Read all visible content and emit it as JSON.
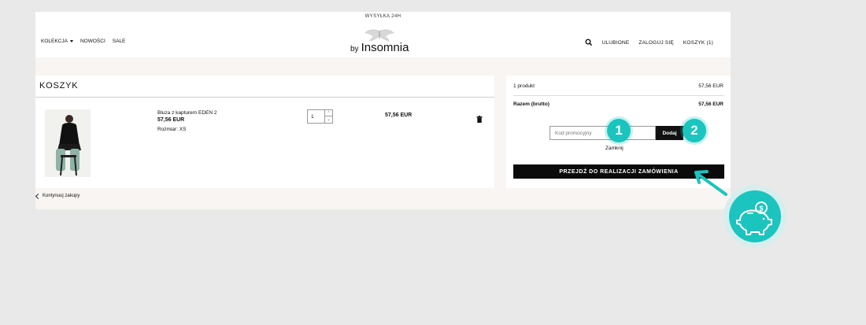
{
  "header": {
    "topbar": "WYSYŁKA 24H",
    "nav_left": [
      {
        "label": "KOLEKCJA"
      },
      {
        "label": "NOWOŚCI"
      },
      {
        "label": "SALE"
      }
    ],
    "logo_by": "by",
    "logo_name": "Insomnia",
    "nav_right": {
      "favorites": "ULUBIONE",
      "login": "ZALOGUJ SIĘ",
      "cart": "KOSZYK (1)"
    }
  },
  "cart": {
    "title": "KOSZYK",
    "item": {
      "name": "Bluza z kapturem EDEN 2",
      "price": "57,56 EUR",
      "size": "Rozmiar: XS",
      "quantity": "1",
      "line_total": "57,56 EUR"
    },
    "continue_label": "Kontynuuj zakupy"
  },
  "summary": {
    "products_label": "1 produkt",
    "products_value": "57,56 EUR",
    "total_label": "Razem (brutto)",
    "total_value": "57,56 EUR",
    "promo_placeholder": "Kod promocyjny",
    "add_label": "Dodaj",
    "close_label": "Zamknij",
    "checkout_label": "PRZEJDŹ DO REALIZACJI ZAMÓWIENIA"
  },
  "annotations": {
    "step1": "1",
    "step2": "2",
    "accent_color": "#1bc4be"
  }
}
